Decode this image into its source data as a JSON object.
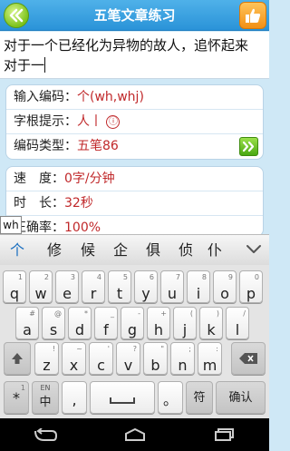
{
  "header": {
    "title": "五笔文章练习",
    "back_icon": "back-double-chevron-icon",
    "thumb_icon": "thumbs-up-icon"
  },
  "article": {
    "line1": "对于一个已经化为异物的故人，追怀起来",
    "line2": "对于一"
  },
  "info": {
    "code_label": "输入编码：",
    "code_value": "个(wh,whj)",
    "root_label": "字根提示：",
    "root_value": "人丨",
    "root_circle": "ⓘ",
    "type_label": "编码类型：",
    "type_value": "五笔86"
  },
  "stats": {
    "speed_label": "速　度：",
    "speed_value": "0字/分钟",
    "time_label": "时　长：",
    "time_value": "32秒",
    "acc_label": "正确率：",
    "acc_value": "100%"
  },
  "ime": {
    "composition": "wh",
    "candidates": [
      "个",
      "修",
      "候",
      "企",
      "俱",
      "侦",
      "仆"
    ]
  },
  "keyboard": {
    "row1": [
      {
        "k": "q",
        "s": "1"
      },
      {
        "k": "w",
        "s": "2"
      },
      {
        "k": "e",
        "s": "3"
      },
      {
        "k": "r",
        "s": "4"
      },
      {
        "k": "t",
        "s": "5"
      },
      {
        "k": "y",
        "s": "6"
      },
      {
        "k": "u",
        "s": "7"
      },
      {
        "k": "i",
        "s": "8"
      },
      {
        "k": "o",
        "s": "9"
      },
      {
        "k": "p",
        "s": "0"
      }
    ],
    "row2": [
      {
        "k": "a",
        "s": "#"
      },
      {
        "k": "s",
        "s": "@"
      },
      {
        "k": "d",
        "s": "*"
      },
      {
        "k": "f",
        "s": "_"
      },
      {
        "k": "g",
        "s": "-"
      },
      {
        "k": "h",
        "s": "+"
      },
      {
        "k": "j",
        "s": "("
      },
      {
        "k": "k",
        "s": ")"
      },
      {
        "k": "l",
        "s": "/"
      }
    ],
    "row3": [
      {
        "k": "z",
        "s": "!"
      },
      {
        "k": "x",
        "s": "~"
      },
      {
        "k": "c",
        "s": "'"
      },
      {
        "k": "v",
        "s": "?"
      },
      {
        "k": "b",
        "s": "\""
      },
      {
        "k": "n",
        "s": ";"
      },
      {
        "k": "m",
        "s": ":"
      }
    ],
    "star": "*",
    "star_sub": "1",
    "lang_top": "EN",
    "lang_main": "中",
    "comma": ",",
    "period": "。",
    "symbol": "符",
    "confirm": "确认"
  },
  "colors": {
    "accent": "#2a93d8",
    "value_red": "#c0282a",
    "go_green": "#4aa812"
  }
}
